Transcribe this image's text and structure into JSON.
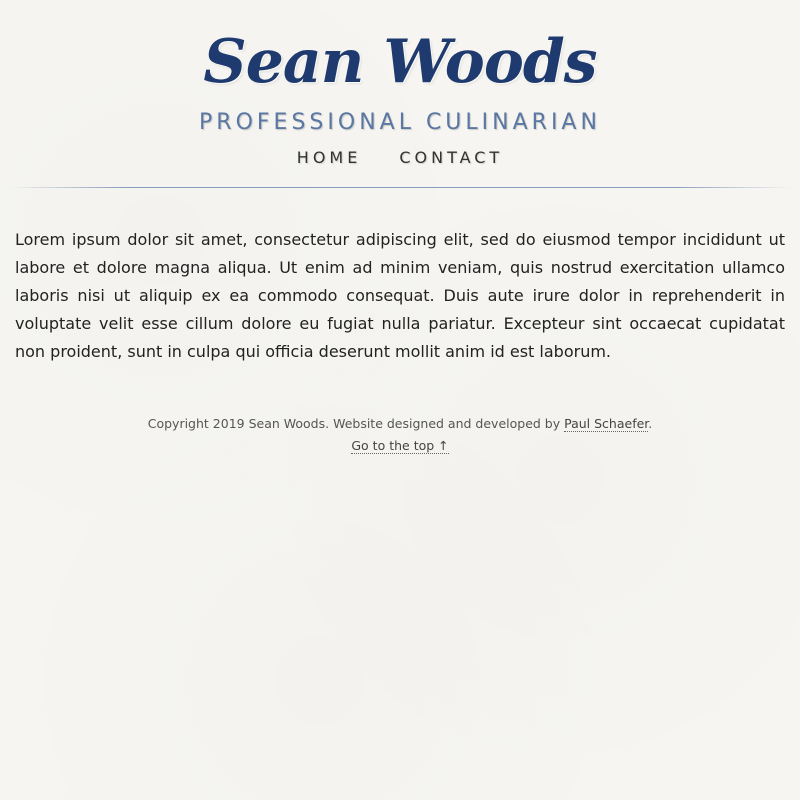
{
  "header": {
    "site_name": "Sean Woods",
    "tagline": "PROFESSIONAL CULINARIAN",
    "nav": [
      {
        "label": "HOME"
      },
      {
        "label": "CONTACT"
      }
    ]
  },
  "main": {
    "body_text": "Lorem ipsum dolor sit amet, consectetur adipiscing elit, sed do eiusmod tempor incididunt ut labore et dolore magna aliqua. Ut enim ad minim veniam, quis nostrud exercitation ullamco laboris nisi ut aliquip ex ea commodo consequat. Duis aute irure dolor in reprehenderit in voluptate velit esse cillum dolore eu fugiat nulla pariatur. Excepteur sint occaecat cupidatat non proident, sunt in culpa qui officia deserunt mollit anim id est laborum."
  },
  "footer": {
    "copyright_prefix": "Copyright 2019 Sean Woods. Website designed and developed by ",
    "developer_link": "Paul Schaefer",
    "copyright_suffix": ".",
    "back_to_top": "Go to the top ↑"
  },
  "colors": {
    "background": "#f6f5f1",
    "brand_blue": "#1f3a6e",
    "tagline_blue": "#5a77a3",
    "text": "#222222"
  }
}
